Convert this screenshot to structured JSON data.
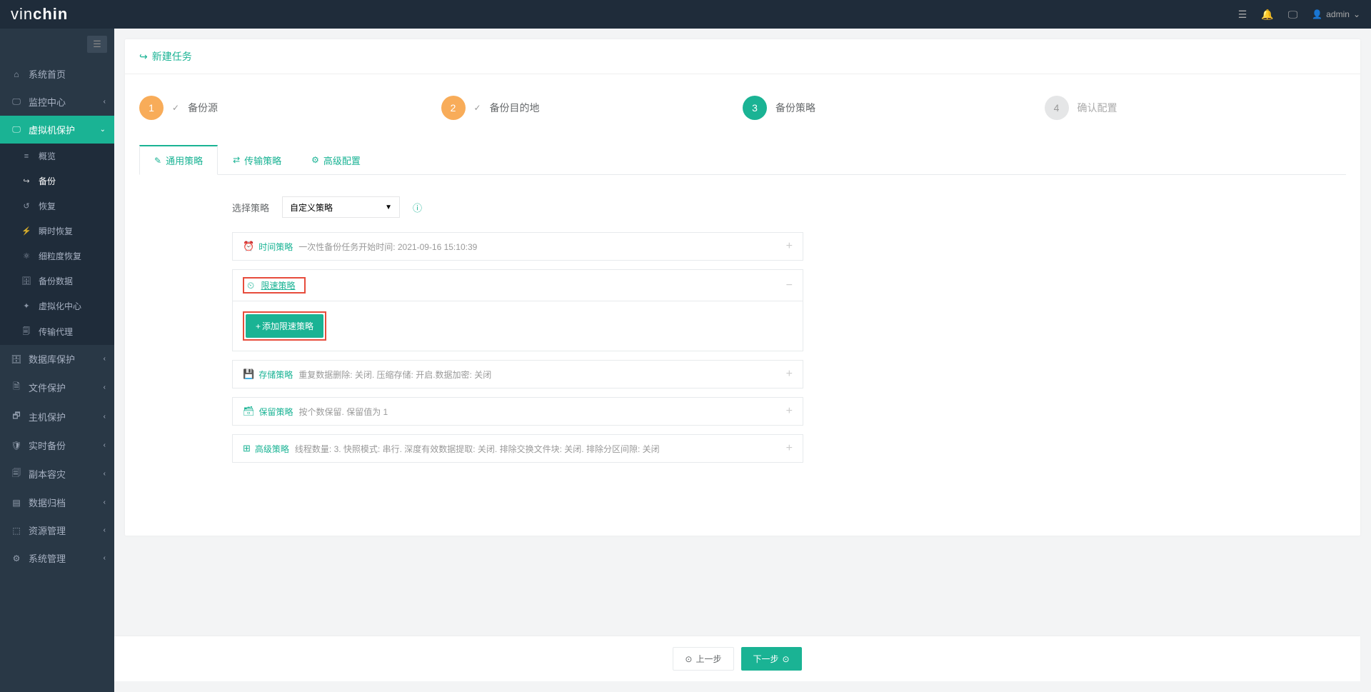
{
  "brand": {
    "part1": "vin",
    "part2": "chin"
  },
  "header": {
    "user": "admin"
  },
  "sidebar": {
    "items": [
      {
        "icon": "⌂",
        "label": "系统首页"
      },
      {
        "icon": "🖵",
        "label": "监控中心",
        "chev": "‹"
      },
      {
        "icon": "🖵",
        "label": "虚拟机保护",
        "chev": "⌄"
      },
      {
        "icon": "🗄",
        "label": "数据库保护",
        "chev": "‹"
      },
      {
        "icon": "🗎",
        "label": "文件保护",
        "chev": "‹"
      },
      {
        "icon": "🗗",
        "label": "主机保护",
        "chev": "‹"
      },
      {
        "icon": "🛡",
        "label": "实时备份",
        "chev": "‹"
      },
      {
        "icon": "🗐",
        "label": "副本容灾",
        "chev": "‹"
      },
      {
        "icon": "▤",
        "label": "数据归档",
        "chev": "‹"
      },
      {
        "icon": "⬚",
        "label": "资源管理",
        "chev": "‹"
      },
      {
        "icon": "⚙",
        "label": "系统管理",
        "chev": "‹"
      }
    ],
    "subs": [
      {
        "icon": "≡",
        "label": "概览"
      },
      {
        "icon": "↪",
        "label": "备份"
      },
      {
        "icon": "↺",
        "label": "恢复"
      },
      {
        "icon": "⚡",
        "label": "瞬时恢复"
      },
      {
        "icon": "⚛",
        "label": "细粒度恢复"
      },
      {
        "icon": "🗄",
        "label": "备份数据"
      },
      {
        "icon": "✦",
        "label": "虚拟化中心"
      },
      {
        "icon": "🗐",
        "label": "传输代理"
      }
    ]
  },
  "page": {
    "title": "新建任务"
  },
  "steps": [
    {
      "num": "1",
      "label": "备份源",
      "state": "done"
    },
    {
      "num": "2",
      "label": "备份目的地",
      "state": "done"
    },
    {
      "num": "3",
      "label": "备份策略",
      "state": "current"
    },
    {
      "num": "4",
      "label": "确认配置",
      "state": "pending"
    }
  ],
  "tabs": [
    {
      "icon": "✎",
      "label": "通用策略"
    },
    {
      "icon": "⇄",
      "label": "传输策略"
    },
    {
      "icon": "⚙",
      "label": "高级配置"
    }
  ],
  "form": {
    "select_label": "选择策略",
    "select_value": "自定义策略"
  },
  "accordion": {
    "time": {
      "title": "时间策略",
      "desc": "一次性备份任务开始时间: 2021-09-16 15:10:39"
    },
    "speed": {
      "title": "限速策略",
      "add_btn": "添加限速策略"
    },
    "storage": {
      "title": "存储策略",
      "desc": "重复数据删除: 关闭. 压缩存储: 开启.数据加密: 关闭"
    },
    "retain": {
      "title": "保留策略",
      "desc": "按个数保留. 保留值为 1"
    },
    "advanced": {
      "title": "高级策略",
      "desc": "线程数量: 3. 快照模式: 串行. 深度有效数据提取: 关闭. 排除交换文件块: 关闭. 排除分区间隙: 关闭"
    }
  },
  "footer": {
    "prev": "上一步",
    "next": "下一步"
  }
}
